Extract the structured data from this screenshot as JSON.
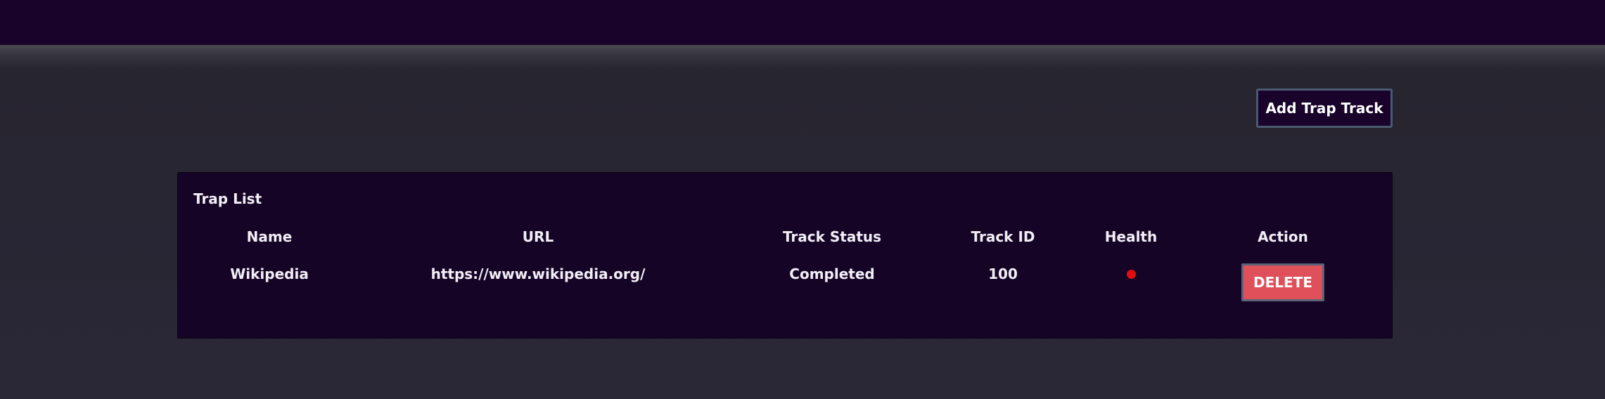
{
  "toolbar": {
    "add_button_label": "Add Trap Track"
  },
  "trap_list": {
    "title": "Trap List",
    "columns": [
      "Name",
      "URL",
      "Track Status",
      "Track ID",
      "Health",
      "Action"
    ],
    "rows": [
      {
        "name": "Wikipedia",
        "url": "https://www.wikipedia.org/",
        "track_status": "Completed",
        "track_id": "100",
        "health_color": "#e00e0e",
        "action_label": "DELETE"
      }
    ]
  },
  "colors": {
    "topbar": "#19032b",
    "page_background": "#272530",
    "panel_background": "#160427",
    "delete_button": "#e0505a",
    "health_indicator": "#e00e0e"
  }
}
